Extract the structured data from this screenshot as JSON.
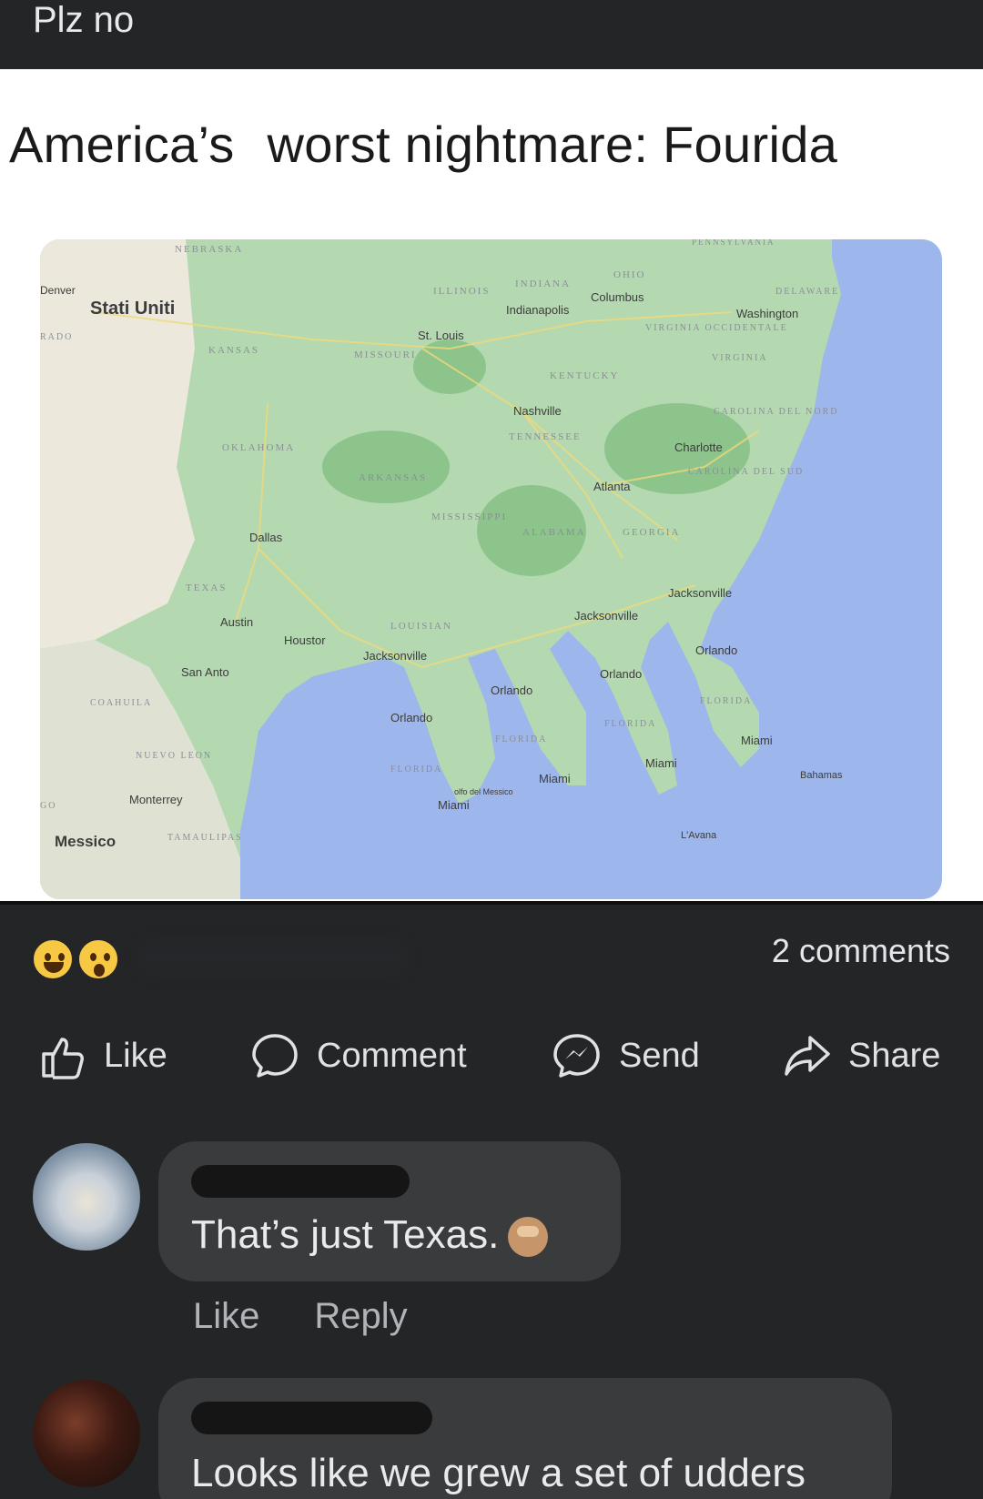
{
  "post": {
    "text": "Plz no"
  },
  "meme": {
    "headline_part1": "America’s",
    "headline_part2": "worst nightmare: Fourida",
    "map": {
      "country_label": "Stati Uniti",
      "cities": [
        "Denver",
        "St. Louis",
        "Indianapolis",
        "Columbus",
        "Washington",
        "Nashville",
        "Charlotte",
        "Atlanta",
        "Dallas",
        "Austin",
        "Houstor",
        "San Anto",
        "Monterrey",
        "Jacksonville",
        "Jacksonville",
        "Jacksonville",
        "Orlando",
        "Orlando",
        "Orlando",
        "Orlando",
        "Miami",
        "Miami",
        "Miami",
        "Miami",
        "Bahamas",
        "L'Avana",
        "Messico"
      ],
      "states": [
        "NEBRASKA",
        "KANSAS",
        "OKLAHOMA",
        "TEXAS",
        "COAHUILA",
        "NUEVO LEON",
        "TAMAULIPAS",
        "MISSOURI",
        "ARKANSAS",
        "LOUISIAN",
        "MISSISSIPPI",
        "ALABAMA",
        "GEORGIA",
        "TENNESSEE",
        "KENTUCKY",
        "ILLINOIS",
        "INDIANA",
        "OHIO",
        "VIRGINIA OCCIDENTALE",
        "VIRGINIA",
        "CAROLINA DEL NORD",
        "CAROLINA DEL SUD",
        "DELAWARE",
        "PENNSYLVANIA",
        "FLORIDA",
        "FLORIDA",
        "FLORIDA",
        "FLORIDA",
        "RADO",
        "GO"
      ],
      "gulf_label": "olfo del Messico"
    }
  },
  "reactions": {
    "emojis": [
      "laughing-face",
      "surprised-face"
    ],
    "comments_count": "2 comments"
  },
  "actions": {
    "like": "Like",
    "comment": "Comment",
    "send": "Send",
    "share": "Share"
  },
  "comments": [
    {
      "text": "That’s just Texas.",
      "emoji": "see-no-evil-monkey",
      "like": "Like",
      "reply": "Reply"
    },
    {
      "text": "Looks like we grew a set of udders"
    }
  ],
  "colors": {
    "background": "#242526",
    "bubble": "#3a3b3c",
    "ocean": "#9db6eb",
    "land": "#a8d6a7"
  }
}
